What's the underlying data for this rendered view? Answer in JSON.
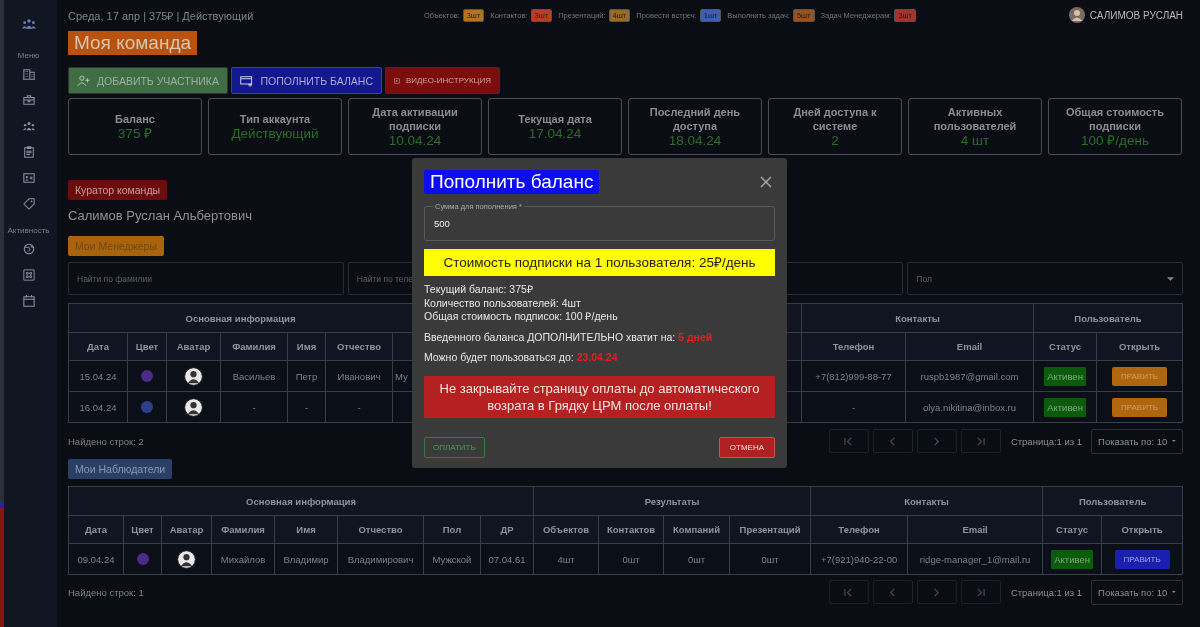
{
  "sidebar": {
    "sections": [
      {
        "label": "Меню"
      },
      {
        "label": "Активность"
      }
    ]
  },
  "topbar": {
    "status": "Среда, 17 апр | 375₽ | Действующий",
    "counters": [
      {
        "label": "Объектов:",
        "value": "3шт",
        "color": "#b5741a"
      },
      {
        "label": "Контактов:",
        "value": "3шт",
        "color": "#b8401d"
      },
      {
        "label": "Презентаций:",
        "value": "4шт",
        "color": "#9c6a22"
      },
      {
        "label": "Провести встреч:",
        "value": "1шт",
        "color": "#3a5fb5"
      },
      {
        "label": "Выполнить задач:",
        "value": "5шт",
        "color": "#98521e"
      },
      {
        "label": "Задач Менеджерам:",
        "value": "3шт",
        "color": "#a8322a"
      }
    ],
    "user": "САЛИМОВ РУСЛАН"
  },
  "title": "Моя команда",
  "actions": [
    {
      "label": "ДОБАВИТЬ УЧАСТНИКА",
      "kind": "add"
    },
    {
      "label": "ПОПОЛНИТЬ БАЛАНС",
      "kind": "topup"
    },
    {
      "label": "ВИДЕО-ИНСТРУКЦИЯ",
      "kind": "video"
    }
  ],
  "cards": [
    {
      "label": "Баланс",
      "value": "375 ₽"
    },
    {
      "label": "Тип аккаунта",
      "value": "Действующий"
    },
    {
      "label": "Дата активации подписки",
      "value": "10.04.24"
    },
    {
      "label": "Текущая дата",
      "value": "17.04.24"
    },
    {
      "label": "Последний день доступа",
      "value": "18.04.24"
    },
    {
      "label": "Дней доступа к системе",
      "value": "2"
    },
    {
      "label": "Активных пользователей",
      "value": "4 шт"
    },
    {
      "label": "Общая стоимость подписки",
      "value": "100 ₽/день"
    }
  ],
  "curator": {
    "badge": "Куратор команды",
    "name": "Салимов Руслан Альбертович"
  },
  "managers": {
    "badge": "Мои Менеджеры",
    "filters": [
      {
        "placeholder": "Найти по фамилии",
        "kind": "search"
      },
      {
        "placeholder": "Найти по теле",
        "kind": "search"
      },
      {
        "kind": "search"
      },
      {
        "placeholder": "Пол",
        "kind": "select"
      }
    ],
    "table": {
      "group_main": "Основная информация",
      "group_contacts": "Контакты",
      "group_user": "Пользователь",
      "columns_main": [
        "Дата",
        "Цвет",
        "Аватар",
        "Фамилия",
        "Имя",
        "Отчество"
      ],
      "columns_right": [
        "Телефон",
        "Email",
        "Статус",
        "Открыть"
      ],
      "rows": [
        {
          "date": "15.04.24",
          "color": "#4b2a8a",
          "surname": "Васильев",
          "name": "Петр",
          "patronymic": "Иванович",
          "gender": "Му",
          "phone": "+7(812)999-88-77",
          "email": "ruspb1987@gmail.com",
          "status": "Активен",
          "action": {
            "label": "ПРАВИТЬ",
            "color": "#b0650f"
          }
        },
        {
          "date": "16.04.24",
          "color": "#2b3f8c",
          "surname": "-",
          "name": "-",
          "patronymic": "-",
          "phone": "-",
          "email": "olya.nikitina@inbox.ru",
          "status": "Активен",
          "action": {
            "label": "ПРАВИТЬ",
            "color": "#b0650f"
          }
        }
      ]
    },
    "found": "Найдено строк:  2",
    "page": "Страница:1 из 1",
    "page_size": "Показать по: 10"
  },
  "observers": {
    "badge": "Мои Наблюдатели",
    "table": {
      "groups": [
        {
          "label": "Основная информация"
        },
        {
          "label": "Результаты"
        },
        {
          "label": "Контакты"
        },
        {
          "label": "Пользователь"
        }
      ],
      "columns": [
        "Дата",
        "Цвет",
        "Аватар",
        "Фамилия",
        "Имя",
        "Отчество",
        "Пол",
        "ДР",
        "Объектов",
        "Контактов",
        "Компаний",
        "Презентаций",
        "Телефон",
        "Email",
        "Статус",
        "Открыть"
      ],
      "rows": [
        {
          "date": "09.04.24",
          "color": "#4b2a8a",
          "surname": "Михайлов",
          "name": "Владимир",
          "patronymic": "Владимирович",
          "gender": "Мужской",
          "birthday": "07.04.61",
          "objects": "4шт",
          "contacts": "0шт",
          "companies": "0шт",
          "presentations": "0шт",
          "phone": "+7(921)940-22-00",
          "email": "ridge-manager_1@mail.ru",
          "status": "Активен",
          "action": {
            "label": "ПРАВИТЬ",
            "color": "#1a1fb0"
          }
        }
      ]
    },
    "found": "Найдено строк:  1",
    "page": "Страница:1 из 1",
    "page_size": "Показать по: 10"
  },
  "modal": {
    "title": "Пополнить баланс",
    "field": {
      "label": "Сумма для пополнения *",
      "value": "500"
    },
    "price": "Стоимость подписки на 1 пользователя: 25₽/день",
    "info": [
      "Текущий баланс: 375₽",
      "Количество пользователей: 4шт",
      "Общая стоимость подписок: 100 ₽/день"
    ],
    "extra": {
      "label": "Введенного баланса ДОПОЛНИТЕЛЬНО хватит на:",
      "value": "5 дней"
    },
    "until": {
      "label": "Можно будет пользоваться до:",
      "value": "23.04.24"
    },
    "warning": "Не закрывайте страницу оплаты до автоматического возрата в Грядку ЦРМ после оплаты!",
    "pay": "ОПЛАТИТЬ",
    "cancel": "ОТМЕНА"
  }
}
